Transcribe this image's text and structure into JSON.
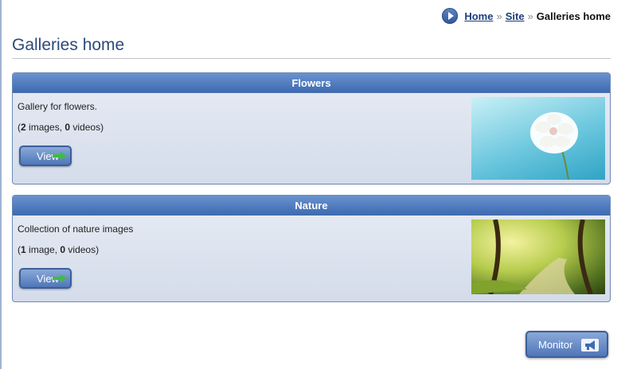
{
  "breadcrumb": {
    "items": [
      {
        "label": "Home"
      },
      {
        "label": "Site"
      }
    ],
    "separator": "»",
    "current": "Galleries home"
  },
  "page": {
    "title": "Galleries home"
  },
  "galleries": [
    {
      "title": "Flowers",
      "description": "Gallery for flowers.",
      "image_count": "2",
      "image_word": "images",
      "video_count": "0",
      "video_word": "videos",
      "view_label": "View",
      "thumbnail": "white dahlia flower against blue sky"
    },
    {
      "title": "Nature",
      "description": "Collection of nature images",
      "image_count": "1",
      "image_word": "image",
      "video_count": "0",
      "video_word": "videos",
      "view_label": "View",
      "thumbnail": "sunlit tree-lined path"
    }
  ],
  "monitor": {
    "label": "Monitor",
    "icon": "megaphone-icon"
  },
  "colors": {
    "accent": "#3d6bb2",
    "title": "#2b4a7a",
    "arrow": "#3cbf3c"
  }
}
